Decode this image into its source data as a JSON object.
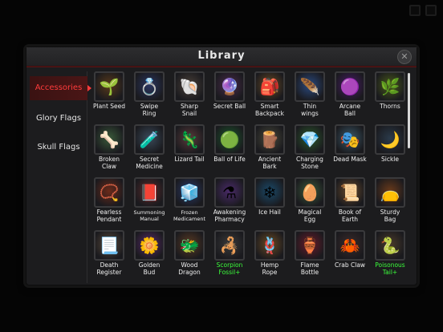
{
  "window": {
    "title": "Library",
    "close_label": "✕"
  },
  "tabs": [
    {
      "label": "Accessories",
      "active": true
    },
    {
      "label": "Glory Flags",
      "active": false
    },
    {
      "label": "Skull Flags",
      "active": false
    }
  ],
  "items": [
    {
      "label": "Plant Seed",
      "icon": "plant-seed-icon",
      "glyph": "🌱",
      "bg": "#5a3a1a"
    },
    {
      "label": "Swipe\nRing",
      "icon": "swipe-ring-icon",
      "glyph": "💍",
      "bg": "#2a3560"
    },
    {
      "label": "Sharp\nSnail",
      "icon": "sharp-snail-icon",
      "glyph": "🐚",
      "bg": "#4a4038"
    },
    {
      "label": "Secret Ball",
      "icon": "secret-ball-icon",
      "glyph": "🔮",
      "bg": "#4a2a4a"
    },
    {
      "label": "Smart\nBackpack",
      "icon": "smart-backpack-icon",
      "glyph": "🎒",
      "bg": "#6a4a22"
    },
    {
      "label": "Thin\nwings",
      "icon": "thin-wings-icon",
      "glyph": "🪶",
      "bg": "#2a4a80"
    },
    {
      "label": "Arcane\nBall",
      "icon": "arcane-ball-icon",
      "glyph": "🟣",
      "bg": "#4a1a6a"
    },
    {
      "label": "Thorns",
      "icon": "thorns-icon",
      "glyph": "🌿",
      "bg": "#4a5a1a"
    },
    {
      "label": "Broken\nClaw",
      "icon": "broken-claw-icon",
      "glyph": "🦴",
      "bg": "#3a5a3a"
    },
    {
      "label": "Secret\nMedicine",
      "icon": "secret-medicine-icon",
      "glyph": "🧪",
      "bg": "#3a4a5a"
    },
    {
      "label": "Lizard Tail",
      "icon": "lizard-tail-icon",
      "glyph": "🦎",
      "bg": "#5a3a3a"
    },
    {
      "label": "Ball of Life",
      "icon": "ball-of-life-icon",
      "glyph": "🟢",
      "bg": "#1a5a2a"
    },
    {
      "label": "Ancient\nBark",
      "icon": "ancient-bark-icon",
      "glyph": "🪵",
      "bg": "#4a4a3a"
    },
    {
      "label": "Charging\nStone",
      "icon": "charging-stone-icon",
      "glyph": "💎",
      "bg": "#2a5a2a"
    },
    {
      "label": "Dead Mask",
      "icon": "dead-mask-icon",
      "glyph": "🎭",
      "bg": "#3a5a6a"
    },
    {
      "label": "Sickle",
      "icon": "sickle-icon",
      "glyph": "🌙",
      "bg": "#2a3a4a"
    },
    {
      "label": "Fearless\nPendant",
      "icon": "fearless-pendant-icon",
      "glyph": "📿",
      "bg": "#6a2a1a"
    },
    {
      "label": "Summoning\nManual",
      "icon": "summoning-manual-icon",
      "glyph": "📕",
      "bg": "#5a2a2a",
      "small": true
    },
    {
      "label": "Frozen\nMedicament",
      "icon": "frozen-medicament-icon",
      "glyph": "🧊",
      "bg": "#2a3a6a",
      "small": true
    },
    {
      "label": "Awakening\nPharmacy",
      "icon": "awakening-pharmacy-icon",
      "glyph": "⚗",
      "bg": "#4a2a6a"
    },
    {
      "label": "Ice Hail",
      "icon": "ice-hail-icon",
      "glyph": "❄",
      "bg": "#1a4a6a"
    },
    {
      "label": "Magical\nEgg",
      "icon": "magical-egg-icon",
      "glyph": "🥚",
      "bg": "#3a5a3a"
    },
    {
      "label": "Book of\nEarth",
      "icon": "book-of-earth-icon",
      "glyph": "📜",
      "bg": "#6a4a2a"
    },
    {
      "label": "Sturdy\nBag",
      "icon": "sturdy-bag-icon",
      "glyph": "👝",
      "bg": "#6a3a1a"
    },
    {
      "label": "Death\nRegister",
      "icon": "death-register-icon",
      "glyph": "📃",
      "bg": "#5a4a3a"
    },
    {
      "label": "Golden\nBud",
      "icon": "golden-bud-icon",
      "glyph": "🌼",
      "bg": "#5a2a6a"
    },
    {
      "label": "Wood\nDragon",
      "icon": "wood-dragon-icon",
      "glyph": "🐲",
      "bg": "#5a3a22"
    },
    {
      "label": "Scorpion\nFossil+",
      "icon": "scorpion-fossil-icon",
      "glyph": "🦂",
      "bg": "#3a3a3a",
      "green": true
    },
    {
      "label": "Hemp\nRope",
      "icon": "hemp-rope-icon",
      "glyph": "🪢",
      "bg": "#6a4a22"
    },
    {
      "label": "Flame\nBottle",
      "icon": "flame-bottle-icon",
      "glyph": "🏺",
      "bg": "#6a1a2a"
    },
    {
      "label": "Crab Claw",
      "icon": "crab-claw-icon",
      "glyph": "🦀",
      "bg": "#3a2a2a"
    },
    {
      "label": "Poisonous\nTail+",
      "icon": "poisonous-tail-icon",
      "glyph": "🐍",
      "bg": "#4a3a2a",
      "green": true
    }
  ]
}
